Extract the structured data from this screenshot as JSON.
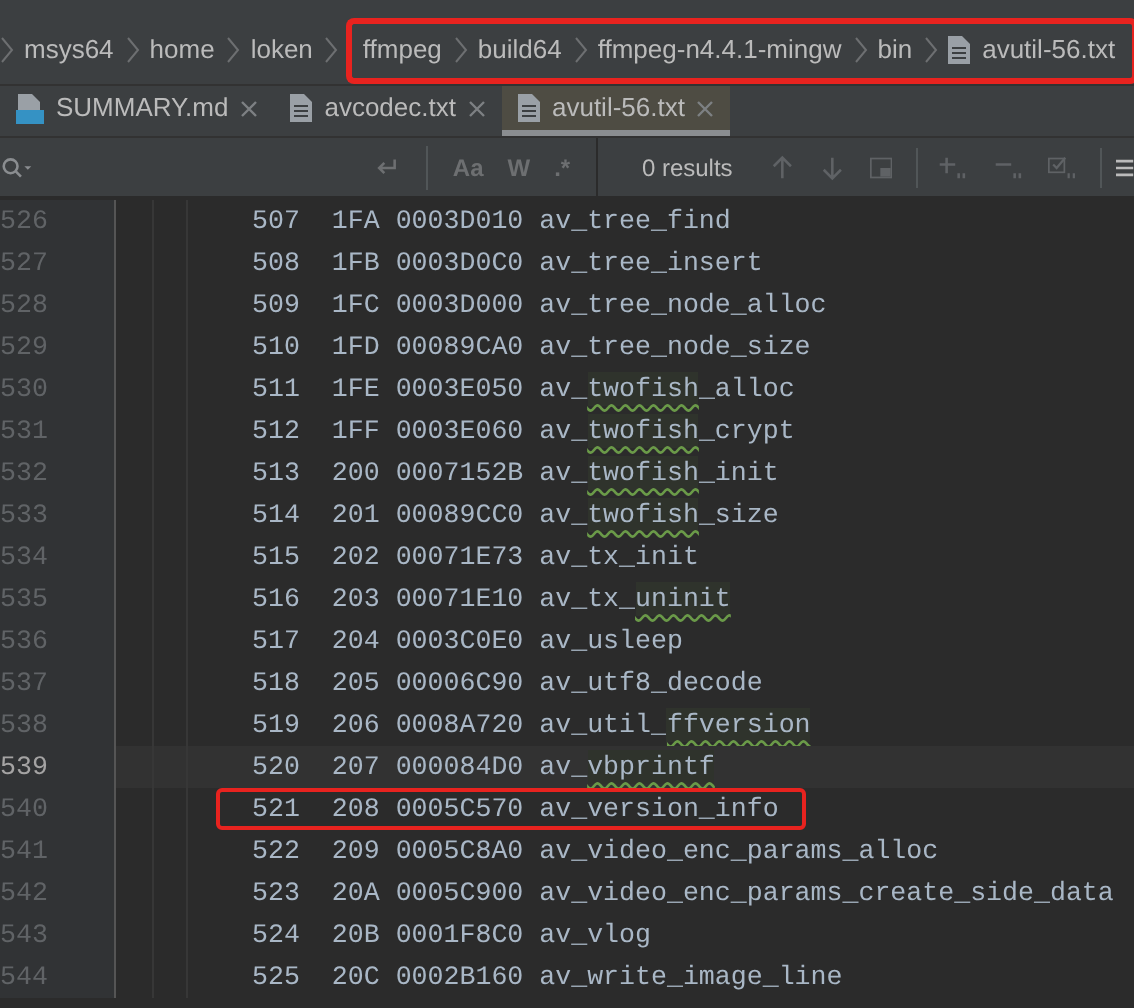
{
  "breadcrumbs": [
    {
      "label": "msys64",
      "file": false,
      "highlighted": false
    },
    {
      "label": "home",
      "file": false,
      "highlighted": false
    },
    {
      "label": "loken",
      "file": false,
      "highlighted": false
    },
    {
      "label": "ffmpeg",
      "file": false,
      "highlighted": true
    },
    {
      "label": "build64",
      "file": false,
      "highlighted": true
    },
    {
      "label": "ffmpeg-n4.4.1-mingw",
      "file": false,
      "highlighted": true
    },
    {
      "label": "bin",
      "file": false,
      "highlighted": true
    },
    {
      "label": "avutil-56.txt",
      "file": true,
      "highlighted": true
    }
  ],
  "tabs": [
    {
      "label": "SUMMARY.md",
      "kind": "markdown",
      "selected": false
    },
    {
      "label": "avcodec.txt",
      "kind": "text",
      "selected": false
    },
    {
      "label": "avutil-56.txt",
      "kind": "text",
      "selected": true
    }
  ],
  "search": {
    "results": "0 results",
    "toggles": [
      {
        "label": "Aa",
        "on": false
      },
      {
        "label": "W",
        "on": false
      },
      {
        "label": ".*",
        "on": false
      }
    ]
  },
  "editor": {
    "lines": [
      {
        "number": "526",
        "current": false,
        "highlighted": false,
        "code": [
          {
            "text": "507  1FA 0003D010 av_tree_find",
            "flagged": false
          }
        ]
      },
      {
        "number": "527",
        "current": false,
        "highlighted": false,
        "code": [
          {
            "text": "508  1FB 0003D0C0 av_tree_insert",
            "flagged": false
          }
        ]
      },
      {
        "number": "528",
        "current": false,
        "highlighted": false,
        "code": [
          {
            "text": "509  1FC 0003D000 av_tree_node_alloc",
            "flagged": false
          }
        ]
      },
      {
        "number": "529",
        "current": false,
        "highlighted": false,
        "code": [
          {
            "text": "510  1FD 00089CA0 av_tree_node_size",
            "flagged": false
          }
        ]
      },
      {
        "number": "530",
        "current": false,
        "highlighted": false,
        "code": [
          {
            "text": "511  1FE 0003E050 av_",
            "flagged": false
          },
          {
            "text": "twofish",
            "flagged": true
          },
          {
            "text": "_alloc",
            "flagged": false
          }
        ]
      },
      {
        "number": "531",
        "current": false,
        "highlighted": false,
        "code": [
          {
            "text": "512  1FF 0003E060 av_",
            "flagged": false
          },
          {
            "text": "twofish",
            "flagged": true
          },
          {
            "text": "_crypt",
            "flagged": false
          }
        ]
      },
      {
        "number": "532",
        "current": false,
        "highlighted": false,
        "code": [
          {
            "text": "513  200 0007152B av_",
            "flagged": false
          },
          {
            "text": "twofish",
            "flagged": true
          },
          {
            "text": "_init",
            "flagged": false
          }
        ]
      },
      {
        "number": "533",
        "current": false,
        "highlighted": false,
        "code": [
          {
            "text": "514  201 00089CC0 av_",
            "flagged": false
          },
          {
            "text": "twofish",
            "flagged": true
          },
          {
            "text": "_size",
            "flagged": false
          }
        ]
      },
      {
        "number": "534",
        "current": false,
        "highlighted": false,
        "code": [
          {
            "text": "515  202 00071E73 av_tx_init",
            "flagged": false
          }
        ]
      },
      {
        "number": "535",
        "current": false,
        "highlighted": false,
        "code": [
          {
            "text": "516  203 00071E10 av_tx_",
            "flagged": false
          },
          {
            "text": "uninit",
            "flagged": true
          }
        ]
      },
      {
        "number": "536",
        "current": false,
        "highlighted": false,
        "code": [
          {
            "text": "517  204 0003C0E0 av_usleep",
            "flagged": false
          }
        ]
      },
      {
        "number": "537",
        "current": false,
        "highlighted": false,
        "code": [
          {
            "text": "518  205 00006C90 av_utf8_decode",
            "flagged": false
          }
        ]
      },
      {
        "number": "538",
        "current": false,
        "highlighted": false,
        "code": [
          {
            "text": "519  206 0008A720 av_util_",
            "flagged": false
          },
          {
            "text": "ffversion",
            "flagged": true
          }
        ]
      },
      {
        "number": "539",
        "current": true,
        "highlighted": false,
        "code": [
          {
            "text": "520  207 000084D0 av_",
            "flagged": false
          },
          {
            "text": "vbprintf",
            "flagged": true
          }
        ]
      },
      {
        "number": "540",
        "current": false,
        "highlighted": true,
        "code": [
          {
            "text": "521  208 0005C570 av_version_info",
            "flagged": false
          }
        ]
      },
      {
        "number": "541",
        "current": false,
        "highlighted": false,
        "code": [
          {
            "text": "522  209 0005C8A0 av_video_enc_params_alloc",
            "flagged": false
          }
        ]
      },
      {
        "number": "542",
        "current": false,
        "highlighted": false,
        "code": [
          {
            "text": "523  20A 0005C900 av_video_enc_params_create_side_data",
            "flagged": false
          }
        ]
      },
      {
        "number": "543",
        "current": false,
        "highlighted": false,
        "code": [
          {
            "text": "524  20B 0001F8C0 av_vlog",
            "flagged": false
          }
        ]
      },
      {
        "number": "544",
        "current": false,
        "highlighted": false,
        "code": [
          {
            "text": "525  20C 0002B160 av_write_image_line",
            "flagged": false
          }
        ]
      }
    ]
  }
}
